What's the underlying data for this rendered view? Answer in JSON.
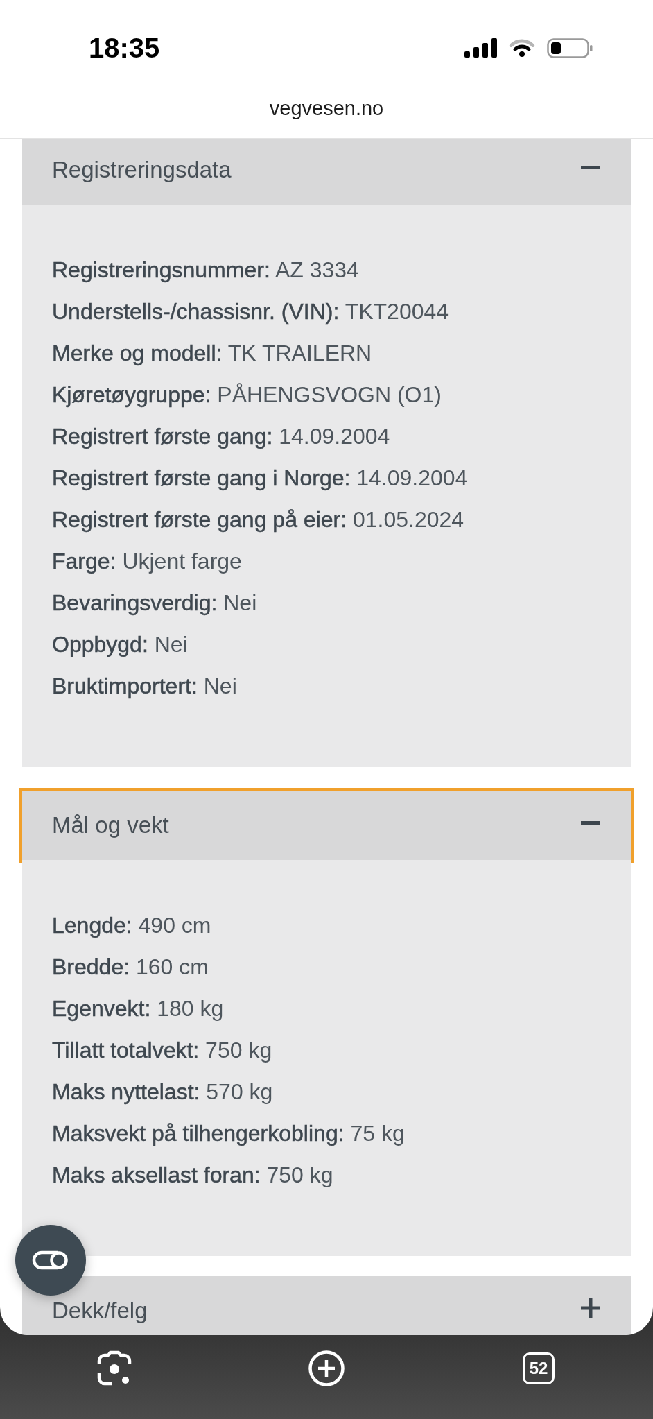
{
  "status_bar": {
    "time": "18:35"
  },
  "address_bar": {
    "url": "vegvesen.no"
  },
  "sections": [
    {
      "title": "Registreringsdata",
      "expanded": true,
      "focused": false,
      "items": [
        {
          "label": "Registreringsnummer:",
          "value": "AZ 3334"
        },
        {
          "label": "Understells-/chassisnr. (VIN):",
          "value": "TKT20044"
        },
        {
          "label": "Merke og modell:",
          "value": "TK TRAILERN"
        },
        {
          "label": "Kjøretøygruppe:",
          "value": "PÅHENGSVOGN (O1)"
        },
        {
          "label": "Registrert første gang:",
          "value": "14.09.2004"
        },
        {
          "label": "Registrert første gang i Norge:",
          "value": "14.09.2004"
        },
        {
          "label": "Registrert første gang på eier:",
          "value": "01.05.2024"
        },
        {
          "label": "Farge:",
          "value": "Ukjent farge"
        },
        {
          "label": "Bevaringsverdig:",
          "value": "Nei"
        },
        {
          "label": "Oppbygd:",
          "value": "Nei"
        },
        {
          "label": "Bruktimportert:",
          "value": "Nei"
        }
      ]
    },
    {
      "title": "Mål og vekt",
      "expanded": true,
      "focused": true,
      "items": [
        {
          "label": "Lengde:",
          "value": "490 cm"
        },
        {
          "label": "Bredde:",
          "value": "160 cm"
        },
        {
          "label": "Egenvekt:",
          "value": "180 kg"
        },
        {
          "label": "Tillatt totalvekt:",
          "value": "750 kg"
        },
        {
          "label": "Maks nyttelast:",
          "value": "570 kg"
        },
        {
          "label": "Maksvekt på tilhengerkobling:",
          "value": "75 kg"
        },
        {
          "label": "Maks aksellast foran:",
          "value": "750 kg"
        }
      ]
    },
    {
      "title": "Dekk/felg",
      "expanded": false,
      "focused": false
    }
  ],
  "bottom_toolbar": {
    "tab_count": "52"
  }
}
